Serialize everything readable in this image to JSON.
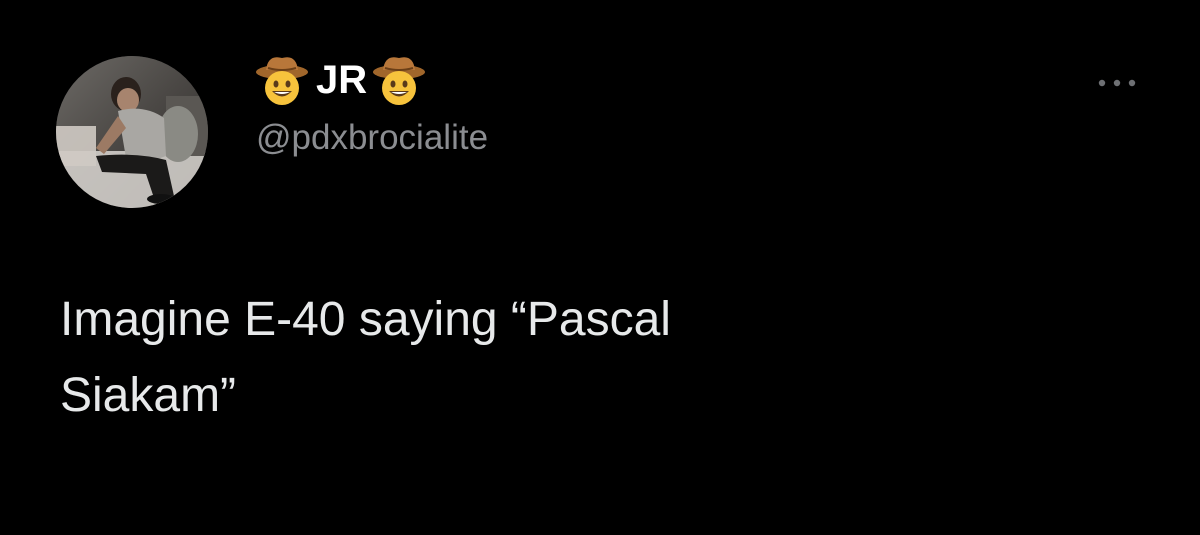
{
  "tweet": {
    "display_name": "JR",
    "name_emoji_left": "cowboy-hat-face-icon",
    "name_emoji_right": "cowboy-hat-face-icon",
    "handle": "@pdxbrocialite",
    "text": "Imagine E-40 saying “Pascal\nSiakam”",
    "more_icon": "more-horizontal-icon",
    "avatar_icon": "avatar-photo"
  },
  "colors": {
    "background": "#000000",
    "name": "#ffffff",
    "handle": "#8b8d91",
    "text": "#e7e9ea"
  }
}
